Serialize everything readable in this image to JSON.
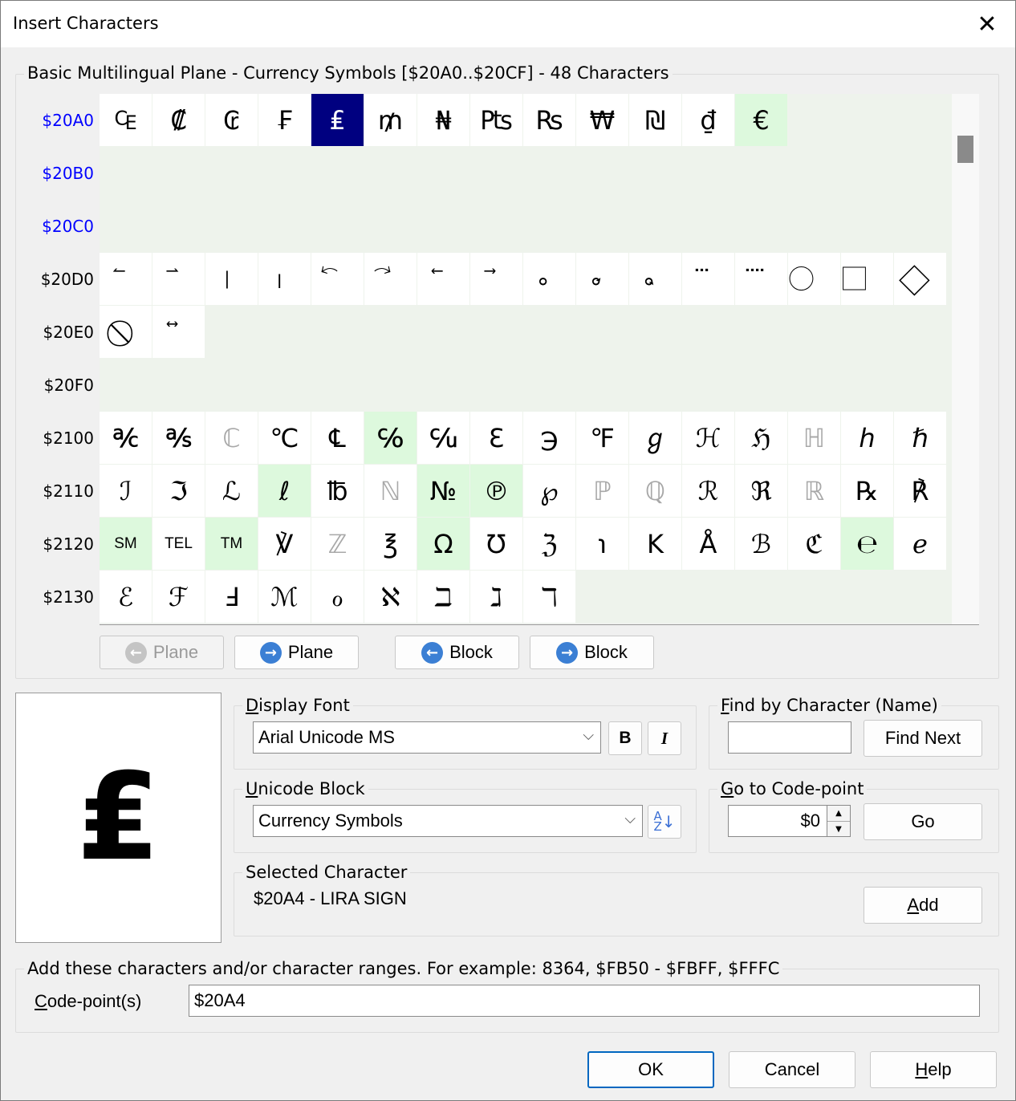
{
  "window": {
    "title": "Insert Characters"
  },
  "grid_section": {
    "label": "Basic Multilingual Plane - Currency Symbols [$20A0..$20CF] - 48 Characters",
    "rows": [
      {
        "label": "$20A0",
        "in_block": true,
        "chars": [
          "₠",
          "₡",
          "₢",
          "₣",
          "₤",
          "₥",
          "₦",
          "₧",
          "₨",
          "₩",
          "₪",
          "₫",
          "€",
          "",
          "",
          ""
        ]
      },
      {
        "label": "$20B0",
        "in_block": true,
        "chars": [
          "",
          "",
          "",
          "",
          "",
          "",
          "",
          "",
          "",
          "",
          "",
          "",
          "",
          "",
          "",
          ""
        ]
      },
      {
        "label": "$20C0",
        "in_block": true,
        "chars": [
          "",
          "",
          "",
          "",
          "",
          "",
          "",
          "",
          "",
          "",
          "",
          "",
          "",
          "",
          "",
          ""
        ]
      },
      {
        "label": "$20D0",
        "in_block": false,
        "chars": [
          "⃐",
          "⃑",
          "⃒",
          "⃓",
          "⃔",
          "⃕",
          "⃖",
          "⃗",
          "⃘",
          "⃙",
          "⃚",
          "⃛",
          "⃜",
          "⃝",
          "⃞",
          "⃟"
        ]
      },
      {
        "label": "$20E0",
        "in_block": false,
        "chars": [
          "⃠",
          "⃡",
          "",
          "",
          "",
          "",
          "",
          "",
          "",
          "",
          "",
          "",
          "",
          "",
          "",
          ""
        ]
      },
      {
        "label": "$20F0",
        "in_block": false,
        "chars": [
          "",
          "",
          "",
          "",
          "",
          "",
          "",
          "",
          "",
          "",
          "",
          "",
          "",
          "",
          "",
          ""
        ]
      },
      {
        "label": "$2100",
        "in_block": false,
        "chars": [
          "℀",
          "℁",
          "ℂ",
          "℃",
          "℄",
          "℅",
          "℆",
          "ℇ",
          "℈",
          "℉",
          "ℊ",
          "ℋ",
          "ℌ",
          "ℍ",
          "ℎ",
          "ℏ"
        ]
      },
      {
        "label": "$2110",
        "in_block": false,
        "chars": [
          "ℐ",
          "ℑ",
          "ℒ",
          "ℓ",
          "℔",
          "ℕ",
          "№",
          "℗",
          "℘",
          "ℙ",
          "ℚ",
          "ℛ",
          "ℜ",
          "ℝ",
          "℞",
          "℟"
        ]
      },
      {
        "label": "$2120",
        "in_block": false,
        "chars": [
          "SM",
          "TEL",
          "TM",
          "℣",
          "ℤ",
          "℥",
          "Ω",
          "℧",
          "ℨ",
          "℩",
          "K",
          "Å",
          "ℬ",
          "ℭ",
          "℮",
          "ℯ"
        ]
      },
      {
        "label": "$2130",
        "in_block": false,
        "chars": [
          "ℰ",
          "ℱ",
          "Ⅎ",
          "ℳ",
          "ℴ",
          "ℵ",
          "ℶ",
          "ℷ",
          "ℸ",
          "",
          "",
          "",
          "",
          "",
          "",
          ""
        ]
      }
    ],
    "selected": {
      "row": 0,
      "col": 4
    },
    "highlighted": [
      [
        0,
        12
      ],
      [
        6,
        5
      ],
      [
        7,
        3
      ],
      [
        7,
        6
      ],
      [
        7,
        7
      ],
      [
        8,
        0
      ],
      [
        8,
        2
      ],
      [
        8,
        6
      ],
      [
        8,
        14
      ]
    ],
    "grey_chars": [
      [
        6,
        2
      ],
      [
        6,
        13
      ],
      [
        7,
        5
      ],
      [
        7,
        9
      ],
      [
        7,
        10
      ],
      [
        7,
        13
      ],
      [
        8,
        4
      ]
    ]
  },
  "nav": {
    "prev_plane": "Plane",
    "next_plane": "Plane",
    "prev_block": "Block",
    "next_block": "Block"
  },
  "preview": {
    "char": "₤"
  },
  "display_font": {
    "label": "Display Font",
    "value": "Arial Unicode MS",
    "bold": "B",
    "italic": "I"
  },
  "unicode_block": {
    "label": "Unicode Block",
    "value": "Currency Symbols"
  },
  "find": {
    "label": "Find by Character (Name)",
    "value": "",
    "button": "Find Next"
  },
  "goto": {
    "label": "Go to Code-point",
    "value": "$0",
    "button": "Go"
  },
  "selected_char": {
    "label": "Selected Character",
    "value": "$20A4 - LIRA SIGN",
    "add_button": "Add"
  },
  "add_section": {
    "label": "Add these characters and/or character ranges. For example: 8364, $FB50 - $FBFF, $FFFC",
    "field_label": "Code-point(s)",
    "value": "$20A4"
  },
  "buttons": {
    "ok": "OK",
    "cancel": "Cancel",
    "help": "Help"
  },
  "colors": {
    "selected_bg": "#000080",
    "highlight_bg": "#ddf9dd",
    "block_label": "#0000ff"
  }
}
